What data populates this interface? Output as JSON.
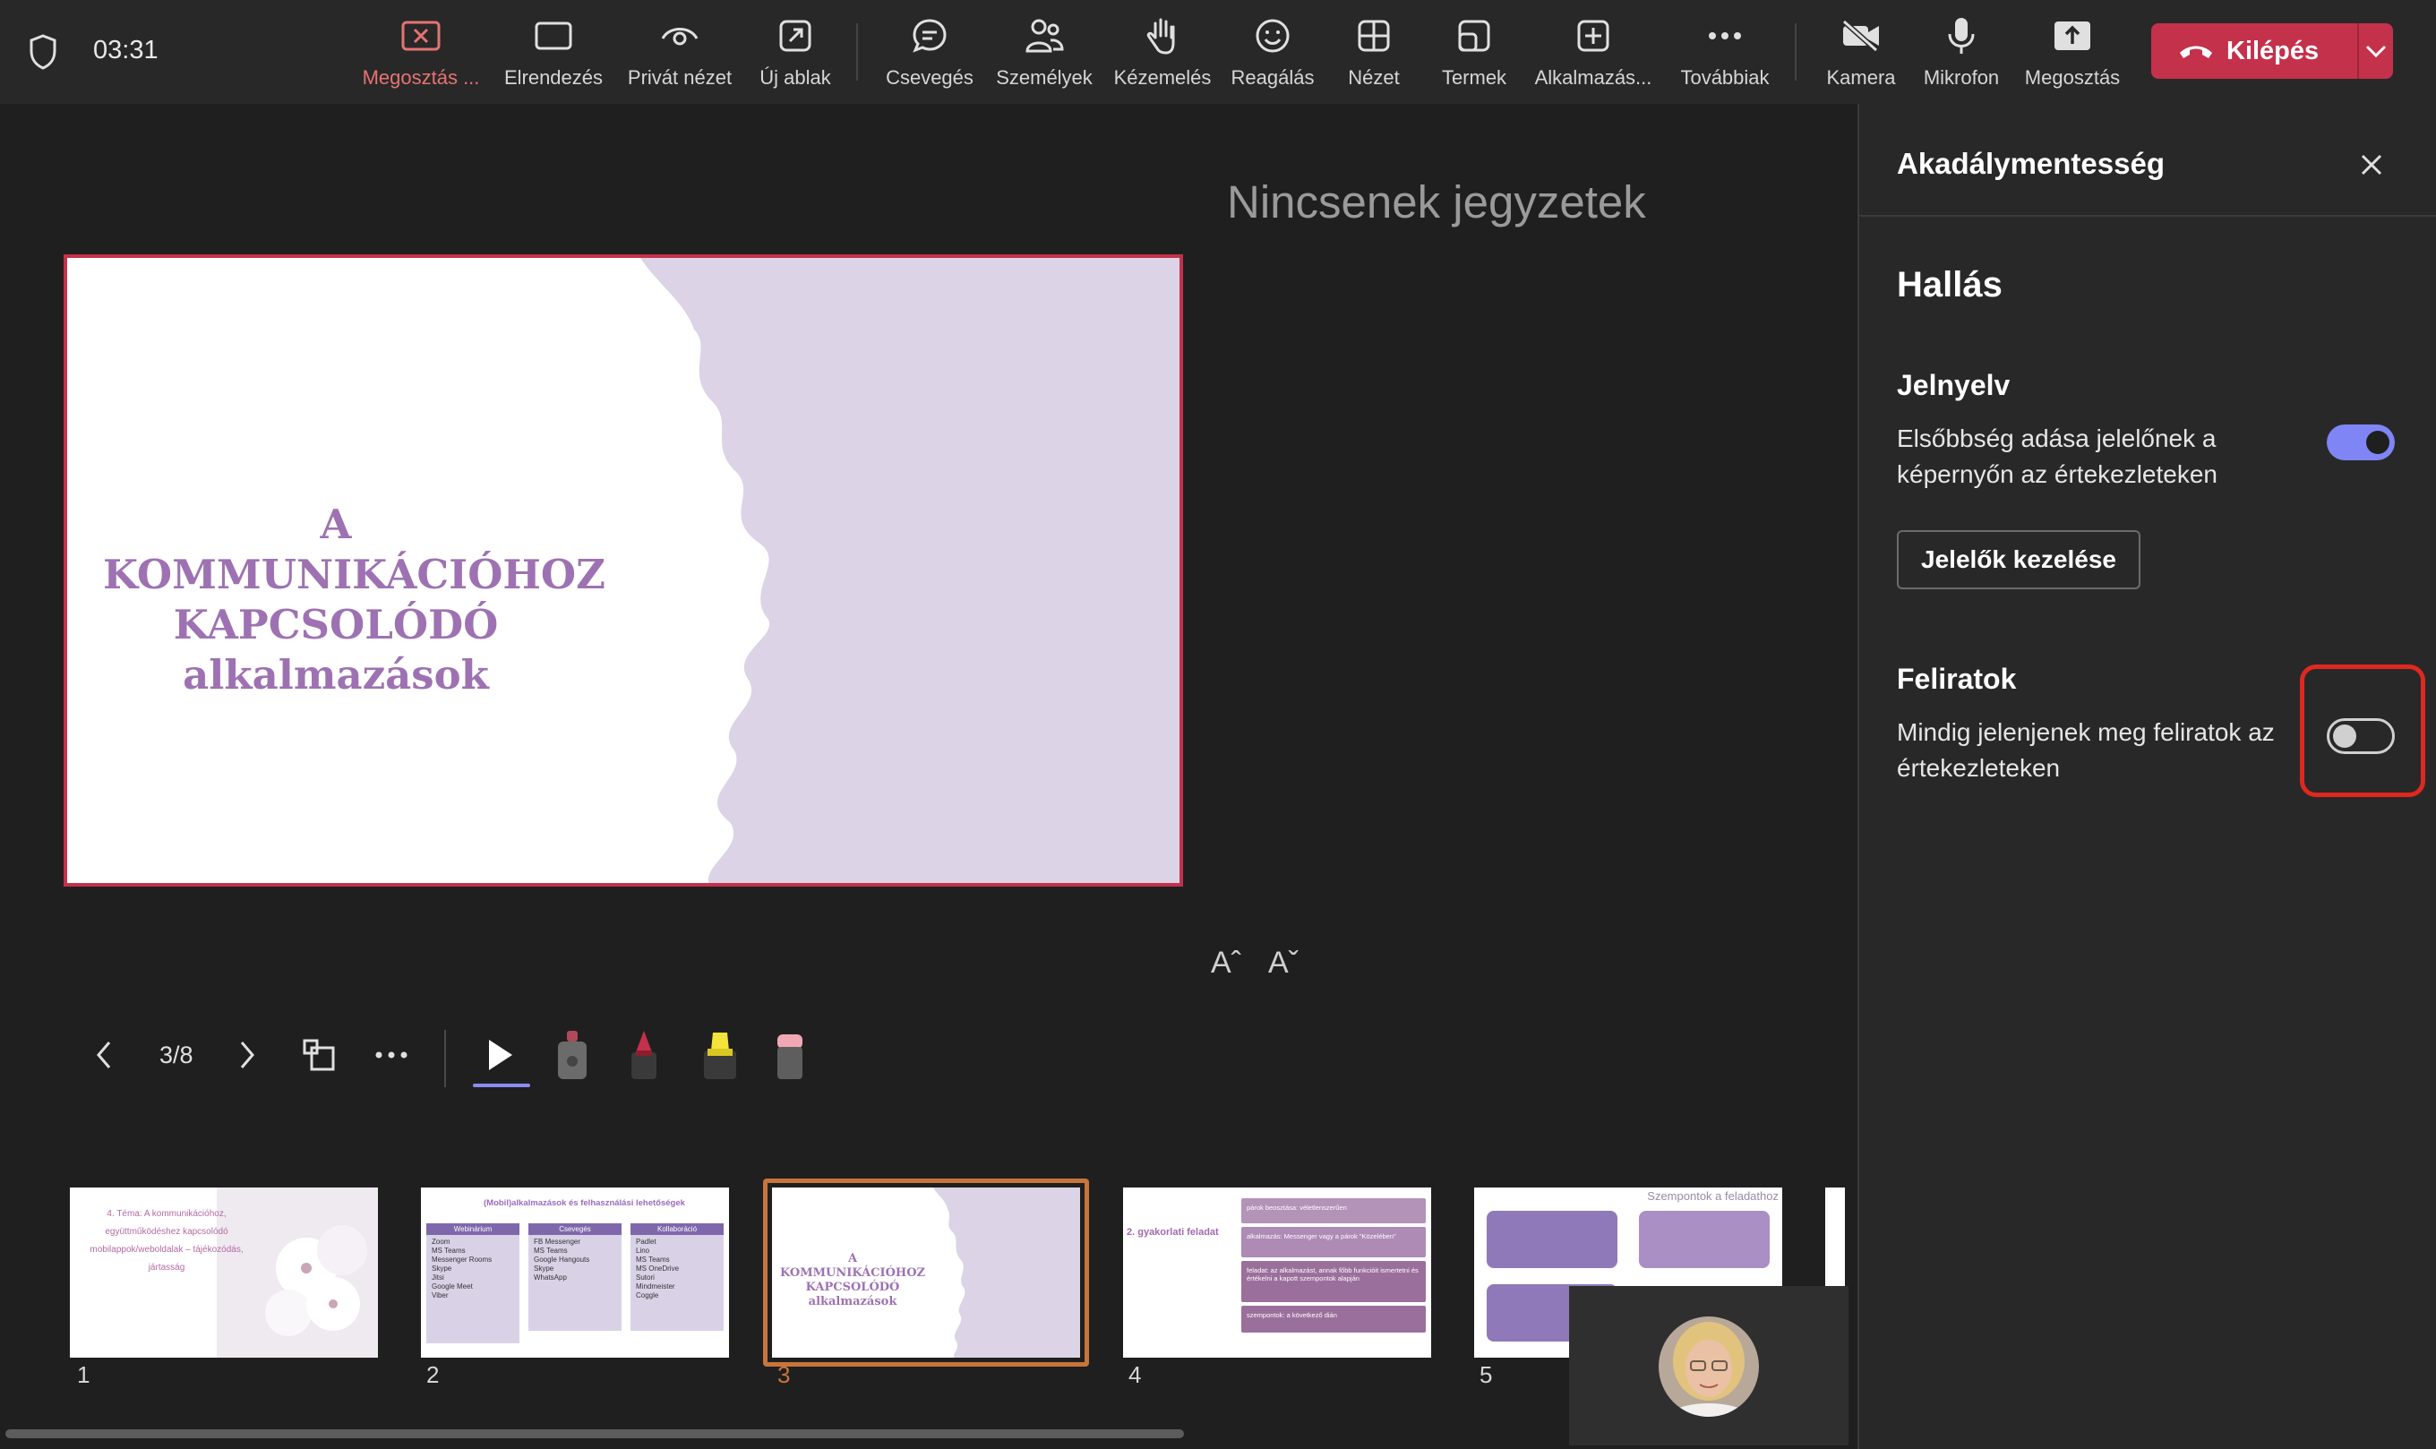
{
  "meeting": {
    "timer": "03:31"
  },
  "toolbar": {
    "items": [
      {
        "label": "Megosztás ...",
        "icon": "stop-share-icon"
      },
      {
        "label": "Elrendezés",
        "icon": "layout-icon"
      },
      {
        "label": "Privát nézet",
        "icon": "private-view-icon"
      },
      {
        "label": "Új ablak",
        "icon": "new-window-icon"
      },
      {
        "label": "Csevegés",
        "icon": "chat-icon"
      },
      {
        "label": "Személyek",
        "icon": "people-icon"
      },
      {
        "label": "Kézemelés",
        "icon": "raise-hand-icon"
      },
      {
        "label": "Reagálás",
        "icon": "react-icon"
      },
      {
        "label": "Nézet",
        "icon": "view-icon"
      },
      {
        "label": "Termek",
        "icon": "rooms-icon"
      },
      {
        "label": "Alkalmazás...",
        "icon": "apps-icon"
      },
      {
        "label": "Továbbiak",
        "icon": "more-icon"
      },
      {
        "label": "Kamera",
        "icon": "camera-off-icon"
      },
      {
        "label": "Mikrofon",
        "icon": "microphone-icon"
      },
      {
        "label": "Megosztás",
        "icon": "share-icon"
      }
    ],
    "leave_label": "Kilépés",
    "accent_red": "#c4314b"
  },
  "stage": {
    "notes_empty": "Nincsenek jegyzetek",
    "slide_title_lines": [
      "A",
      "KOMMUNIKÁCIÓHOZ",
      "KAPCSOLÓDÓ",
      "alkalmazások"
    ],
    "font_increase": "Aˆ",
    "font_decrease": "Aˇ",
    "slide_counter": "3/8"
  },
  "thumbnails": [
    {
      "num": "1",
      "title": "4. Téma: A kommunikációhoz, együttműködéshez kapcsolódó mobilappok/weboldalak – tájékozódás, jártasság"
    },
    {
      "num": "2",
      "title": "(Mobil)alkalmazások és felhasználási lehetőségek",
      "columns": [
        "Webinárium",
        "Csevegés",
        "Kollaboráció"
      ],
      "col1": [
        "Zoom",
        "MS Teams",
        "Messenger Rooms",
        "Skype",
        "Jitsi",
        "Google Meet",
        "Viber"
      ],
      "col2": [
        "FB Messenger",
        "MS Teams",
        "Google Hangouts",
        "Skype",
        "WhatsApp"
      ],
      "col3": [
        "Padlet",
        "Lino",
        "MS Teams",
        "MS OneDrive",
        "Sutori",
        "Mindmeister",
        "Coggle"
      ]
    },
    {
      "num": "3",
      "title_lines": [
        "A",
        "KOMMUNIKÁCIÓHOZ",
        "KAPCSOLÓDÓ",
        "alkalmazások"
      ]
    },
    {
      "num": "4",
      "title": "2. gyakorlati feladat",
      "rows": [
        "párok beosztása: véletlenszerűen",
        "alkalmazás: Messenger vagy a párok \"Közelében\"",
        "feladat: az alkalmazást, annak főbb funkcióit ismertetni és értékelni a kapott szempontok alapján",
        "szempontok: a következő dián"
      ]
    },
    {
      "num": "5",
      "title": "Szempontok a feladathoz"
    }
  ],
  "panel": {
    "title": "Akadálymentesség",
    "section": "Hallás",
    "sign_language": {
      "heading": "Jelnyelv",
      "description": "Elsőbbség adása jelelőnek a képernyőn az értekezleteken",
      "toggle_on": true,
      "button": "Jelelők kezelése"
    },
    "captions": {
      "heading": "Feliratok",
      "description": "Mindig jelenjenek meg feliratok az értekezleteken",
      "toggle_on": false
    },
    "toggle_color": "#7f85f5",
    "highlight_color": "#e0281e"
  }
}
